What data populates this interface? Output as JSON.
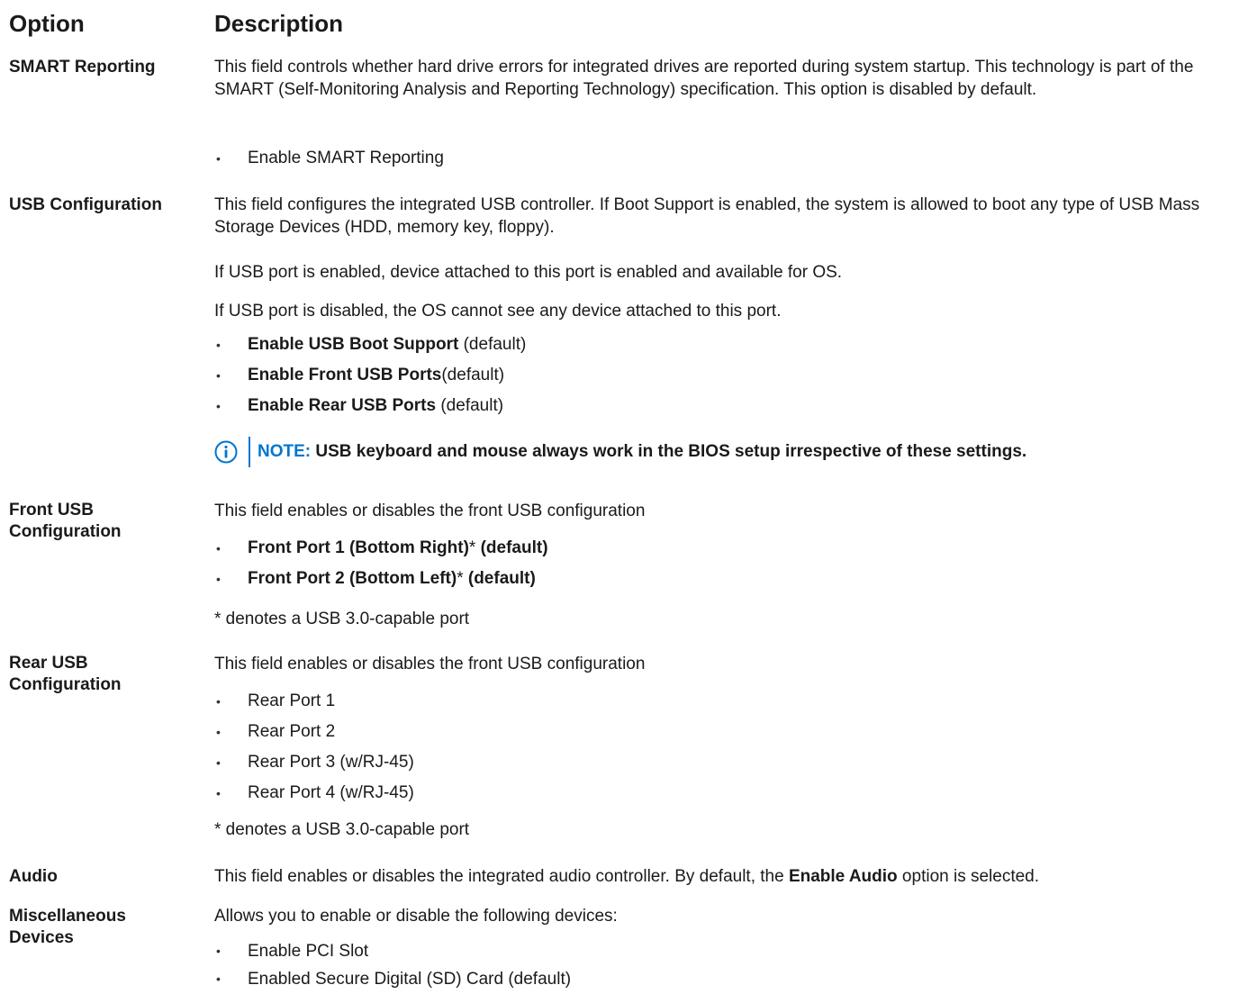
{
  "header": {
    "option": "Option",
    "description": "Description"
  },
  "rows": {
    "smart": {
      "option": "SMART Reporting",
      "text": "This field controls whether hard drive errors for integrated drives are reported during system startup. This technology is part of the SMART (Self-Monitoring Analysis and Reporting Technology) specification. This option is disabled by default.",
      "items": [
        "Enable SMART Reporting"
      ]
    },
    "usb": {
      "option": "USB Configuration",
      "text1": "This field configures the integrated USB controller. If Boot Support is enabled, the system is allowed to boot any type of USB Mass Storage Devices (HDD, memory key, floppy).",
      "text2": "If USB port is enabled, device attached to this port is enabled and available for OS.",
      "text3": "If USB port is disabled, the OS cannot see any device attached to this port.",
      "items": [
        {
          "bold": "Enable USB Boot Support",
          "rest": " (default)"
        },
        {
          "bold": "Enable Front USB Ports",
          "rest": "(default)"
        },
        {
          "bold": "Enable Rear USB Ports",
          "rest": " (default)"
        }
      ],
      "note_label": "NOTE:",
      "note_text": " USB keyboard and mouse always work in the BIOS setup irrespective of these settings."
    },
    "front": {
      "option_line1": "Front USB",
      "option_line2": "Configuration",
      "text": "This field enables or disables the front USB configuration",
      "items": [
        {
          "bold": "Front Port 1 (Bottom Right)",
          "star": "*",
          "tail": " (default)"
        },
        {
          "bold": "Front Port 2 (Bottom Left)",
          "star": "*",
          "tail": " (default)"
        }
      ],
      "footnote": "* denotes a USB 3.0-capable port"
    },
    "rear": {
      "option_line1": "Rear USB",
      "option_line2": "Configuration",
      "text": "This field enables or disables the front USB configuration",
      "items": [
        "Rear Port 1",
        "Rear Port 2",
        "Rear Port 3 (w/RJ-45)",
        "Rear Port 4 (w/RJ-45)"
      ],
      "footnote": "* denotes a USB 3.0-capable port"
    },
    "audio": {
      "option": "Audio",
      "text_before": "This field enables or disables the integrated audio controller. By default, the ",
      "text_bold": "Enable Audio",
      "text_after": " option is selected."
    },
    "misc": {
      "option_line1": "Miscellaneous",
      "option_line2": "Devices",
      "text": "Allows you to enable or disable the following devices:",
      "items": [
        "Enable PCI Slot",
        "Enabled Secure Digital (SD) Card (default)"
      ]
    }
  },
  "colors": {
    "note_accent": "#0076ce",
    "text": "#1a1a1a"
  },
  "icons": {
    "bullet": "•",
    "note": "info-circle-icon"
  }
}
